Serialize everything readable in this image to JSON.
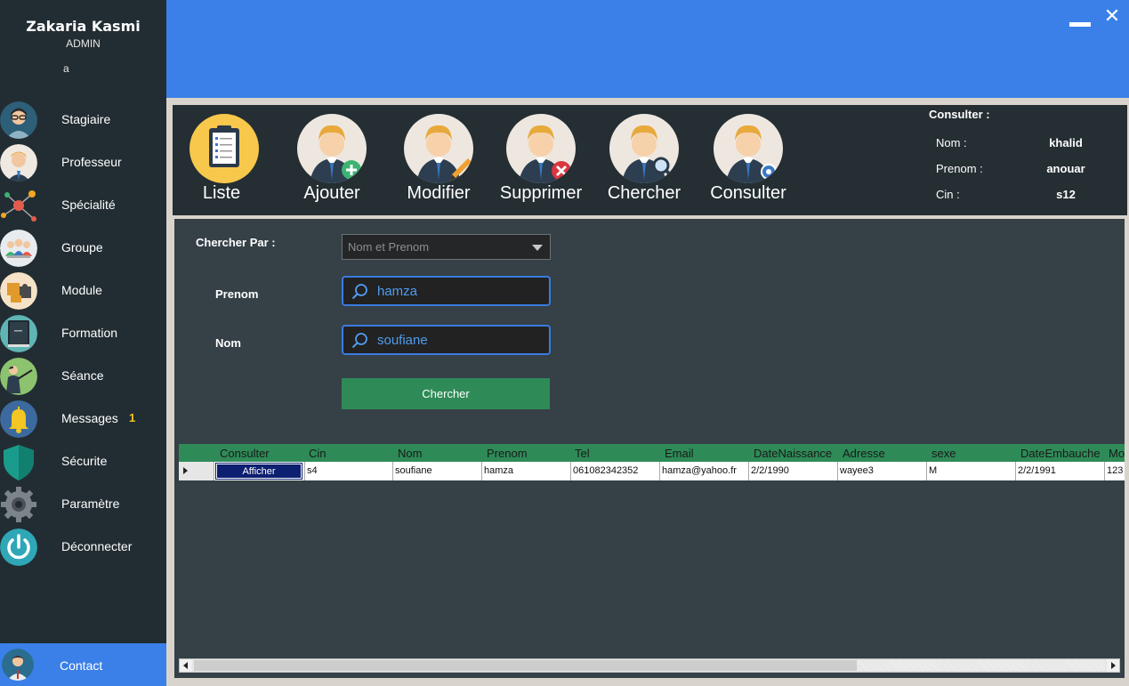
{
  "user": {
    "name": "Zakaria Kasmi",
    "role": "ADMIN",
    "extra": "a"
  },
  "sidebar": {
    "items": [
      {
        "label": "Stagiaire",
        "icon": "trainee-icon"
      },
      {
        "label": "Professeur",
        "icon": "teacher-icon"
      },
      {
        "label": "Spécialité",
        "icon": "specialty-network-icon"
      },
      {
        "label": "Groupe",
        "icon": "group-icon"
      },
      {
        "label": "Module",
        "icon": "puzzle-module-icon"
      },
      {
        "label": "Formation",
        "icon": "book-icon"
      },
      {
        "label": "Séance",
        "icon": "presenter-icon"
      },
      {
        "label": "Messages",
        "icon": "bell-icon",
        "badge": "1"
      },
      {
        "label": "Sécurite",
        "icon": "shield-icon"
      },
      {
        "label": "Paramètre",
        "icon": "gear-icon"
      },
      {
        "label": "Déconnecter",
        "icon": "power-icon"
      }
    ],
    "contact": {
      "label": "Contact",
      "icon": "contact-person-icon"
    }
  },
  "window": {
    "close_glyph": "✕"
  },
  "toolbar": {
    "tools": [
      {
        "label": "Liste",
        "icon": "clipboard-list-icon"
      },
      {
        "label": "Ajouter",
        "icon": "add-person-icon"
      },
      {
        "label": "Modifier",
        "icon": "edit-person-icon"
      },
      {
        "label": "Supprimer",
        "icon": "delete-person-icon"
      },
      {
        "label": "Chercher",
        "icon": "search-person-icon"
      },
      {
        "label": "Consulter",
        "icon": "view-person-icon"
      }
    ]
  },
  "consult": {
    "title": "Consulter :",
    "fields": [
      {
        "key": "Nom :",
        "value": "khalid"
      },
      {
        "key": "Prenom :",
        "value": "anouar"
      },
      {
        "key": "Cin :",
        "value": "s12"
      }
    ]
  },
  "search": {
    "by_label": "Chercher Par :",
    "by_selected": "Nom et Prenom",
    "prenom_label": "Prenom",
    "prenom_value": "hamza",
    "nom_label": "Nom",
    "nom_value": "soufiane",
    "button_label": "Chercher"
  },
  "grid": {
    "columns": [
      "Consulter",
      "Cin",
      "Nom",
      "Prenom",
      "Tel",
      "Email",
      "DateNaissance",
      "Adresse",
      "sexe",
      "DateEmbauche",
      "Mo"
    ],
    "rows": [
      {
        "action": "Afficher",
        "cells": [
          "s4",
          "soufiane",
          "hamza",
          "061082342352",
          "hamza@yahoo.fr",
          "2/2/1990",
          "wayee3",
          "M",
          "2/2/1991",
          "123"
        ]
      }
    ]
  },
  "colors": {
    "sidebar": "#222d33",
    "accent": "#3b80e8",
    "toolbar": "#242e33",
    "panel": "#354047",
    "green": "#2e8b57",
    "badge": "#f3c623"
  }
}
